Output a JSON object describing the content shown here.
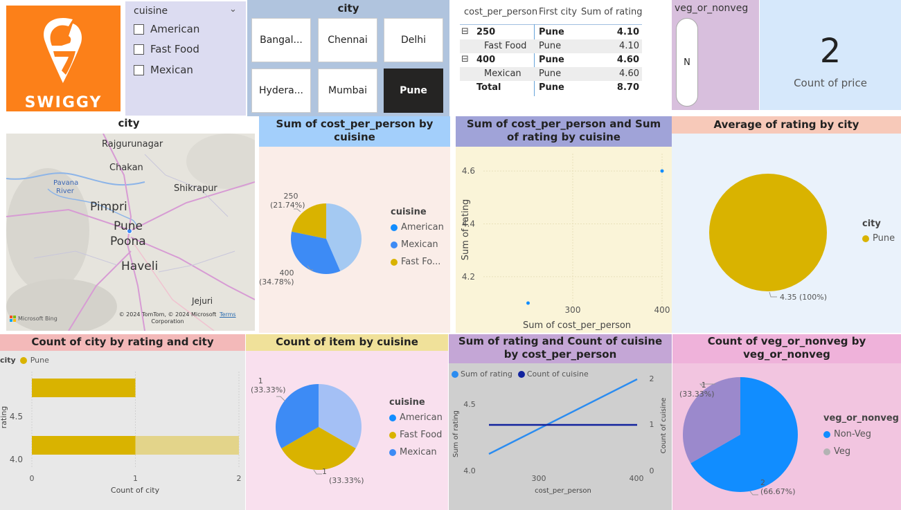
{
  "logo": {
    "text": "SWIGGY",
    "bg": "#FC8019"
  },
  "cuisine_slicer": {
    "title": "cuisine",
    "options": [
      "American",
      "Fast Food",
      "Mexican"
    ]
  },
  "city_slicer": {
    "title": "city",
    "tiles": [
      "Bangal...",
      "Chennai",
      "Delhi",
      "Hydera...",
      "Mumbai",
      "Pune"
    ],
    "selected": "Pune"
  },
  "matrix": {
    "headers": [
      "cost_per_person",
      "First city",
      "Sum of rating"
    ],
    "rows": [
      {
        "expander": "⊟",
        "label": "250",
        "city": "Pune",
        "value": "4.10"
      },
      {
        "expander": "",
        "label": "Fast Food",
        "city": "Pune",
        "value": "4.10"
      },
      {
        "expander": "⊟",
        "label": "400",
        "city": "Pune",
        "value": "4.60"
      },
      {
        "expander": "",
        "label": "Mexican",
        "city": "Pune",
        "value": "4.60"
      },
      {
        "expander": "",
        "label": "Total",
        "city": "Pune",
        "value": "8.70"
      }
    ]
  },
  "veg_slicer": {
    "title": "veg_or_nonveg",
    "option": "N"
  },
  "card": {
    "value": "2",
    "label": "Count of price"
  },
  "map": {
    "title": "city",
    "places": [
      "Rajgurunagar",
      "Chakan",
      "Pavana",
      "River",
      "Shikrapur",
      "Pimpri",
      "Pune",
      "Poona",
      "Haveli",
      "Jejuri"
    ],
    "attribution": "© 2024 TomTom, © 2024 Microsoft",
    "attribution2": "Corporation",
    "terms": "Terms",
    "bing": "Microsoft Bing"
  },
  "chart_data": [
    {
      "id": "pie_cost_cuisine",
      "type": "pie",
      "title": "Sum of cost_per_person by cuisine",
      "legend_title": "cuisine",
      "legend": [
        "American",
        "Mexican",
        "Fast Fo..."
      ],
      "slices": [
        {
          "name": "American",
          "value": 43.48,
          "color": "#A4C9F2"
        },
        {
          "name": "Mexican",
          "value": 34.78,
          "color": "#3D8BF5"
        },
        {
          "name": "Fast Food",
          "value": 21.74,
          "color": "#D9B300"
        }
      ],
      "labels": [
        {
          "text1": "250",
          "text2": "(21.74%)"
        },
        {
          "text1": "400",
          "text2": "(34.78%)"
        }
      ]
    },
    {
      "id": "scatter_cost_rating",
      "type": "scatter",
      "title": "Sum of cost_per_person and Sum of rating by cuisine",
      "xlabel": "Sum of cost_per_person",
      "ylabel": "Sum of rating",
      "xticks": [
        "300",
        "400"
      ],
      "yticks": [
        "4.6",
        "4.4",
        "4.2"
      ],
      "xlim": [
        200,
        400
      ],
      "ylim": [
        4.1,
        4.6
      ],
      "points": [
        {
          "x": 250,
          "y": 4.1
        },
        {
          "x": 400,
          "y": 4.6
        }
      ]
    },
    {
      "id": "pie_rating_city",
      "type": "pie",
      "title": "Average of rating by city",
      "legend_title": "city",
      "legend": [
        "Pune"
      ],
      "slices": [
        {
          "name": "Pune",
          "value": 4.35,
          "color": "#D9B300"
        }
      ],
      "label": "4.35 (100%)"
    },
    {
      "id": "bar_city_rating",
      "type": "bar",
      "title": "Count of city by rating and city",
      "legend_title": "city",
      "legend": [
        "Pune"
      ],
      "xlabel": "Count of city",
      "ylabel": "rating",
      "xticks": [
        "0",
        "1",
        "2"
      ],
      "yticks": [
        "4.5",
        "4.0"
      ],
      "xlim": [
        0,
        2
      ],
      "bars": [
        {
          "y": 4.6,
          "value": 1
        },
        {
          "y": 4.1,
          "value": 1
        }
      ],
      "total_value": 2
    },
    {
      "id": "pie_item_cuisine",
      "type": "pie",
      "title": "Count of item by cuisine",
      "legend_title": "cuisine",
      "legend": [
        "American",
        "Fast Food",
        "Mexican"
      ],
      "slices": [
        {
          "name": "American",
          "value": 1,
          "color": "#A4C0F5"
        },
        {
          "name": "Fast Food",
          "value": 1,
          "color": "#D9B300"
        },
        {
          "name": "Mexican",
          "value": 1,
          "color": "#3D8BF5"
        }
      ],
      "labels": [
        {
          "text1": "1",
          "text2": "(33.33%)"
        },
        {
          "text1": "1",
          "text2": "(33.33%)"
        }
      ]
    },
    {
      "id": "line_rating_cuisine",
      "type": "line",
      "title": "Sum of rating and Count of cuisine by cost_per_person",
      "xlabel": "cost_per_person",
      "ylabel": "Sum of rating",
      "y2label": "Count of cuisine",
      "xticks": [
        "300",
        "400"
      ],
      "yticks": [
        "4.5",
        "4.0"
      ],
      "y2ticks": [
        "2",
        "1",
        "0"
      ],
      "series": [
        {
          "name": "Sum of rating",
          "color": "#2B8CF0",
          "x": [
            250,
            400
          ],
          "values": [
            4.1,
            4.6
          ]
        },
        {
          "name": "Count of cuisine",
          "color": "#12239E",
          "x": [
            250,
            400
          ],
          "values": [
            1,
            1
          ]
        }
      ]
    },
    {
      "id": "pie_veg",
      "type": "pie",
      "title": "Count of veg_or_nonveg by veg_or_nonveg",
      "legend_title": "veg_or_nonveg",
      "legend": [
        "Non-Veg",
        "Veg"
      ],
      "slices": [
        {
          "name": "Non-Veg",
          "value": 2,
          "color": "#118DFF"
        },
        {
          "name": "Veg",
          "value": 1,
          "color": "#9B89CC"
        }
      ],
      "labels": [
        {
          "text1": "1",
          "text2": "(33.33%)"
        },
        {
          "text1": "2",
          "text2": "(66.67%)"
        }
      ]
    }
  ]
}
